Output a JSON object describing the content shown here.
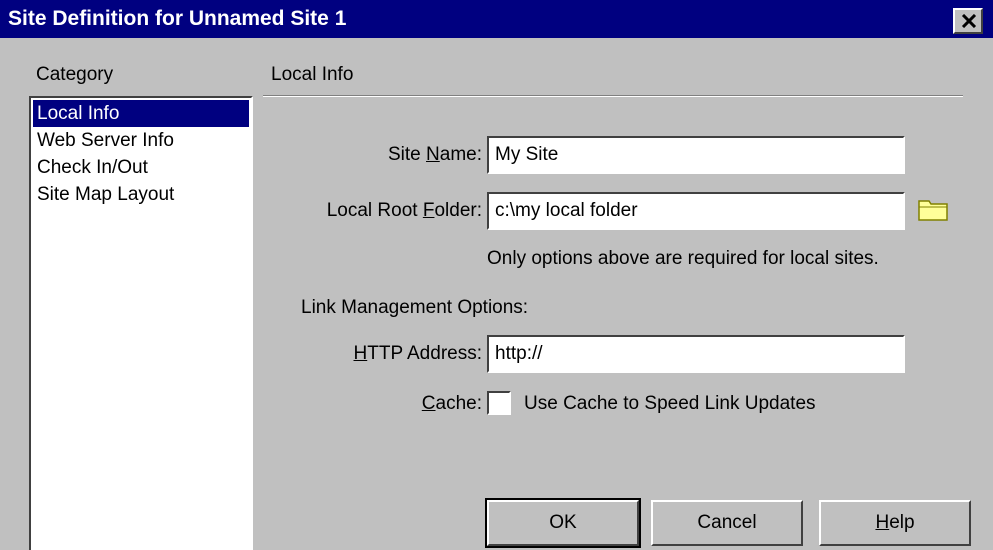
{
  "window": {
    "title": "Site Definition for Unnamed Site 1",
    "close_label": "×"
  },
  "category": {
    "label": "Category",
    "items": [
      {
        "label": "Local Info",
        "selected": true
      },
      {
        "label": "Web Server Info",
        "selected": false
      },
      {
        "label": "Check In/Out",
        "selected": false
      },
      {
        "label": "Site Map Layout",
        "selected": false
      }
    ]
  },
  "section": {
    "title": "Local Info"
  },
  "fields": {
    "site_name": {
      "label_pre": "Site ",
      "label_key": "N",
      "label_post": "ame:",
      "value": "My Site"
    },
    "local_root_folder": {
      "label_pre": "Local Root ",
      "label_key": "F",
      "label_post": "older:",
      "value": "c:\\my local folder"
    },
    "required_note": "Only options above are required for local sites.",
    "link_management_label": "Link Management Options:",
    "http_address": {
      "label_pre": "",
      "label_key": "H",
      "label_post": "TTP Address:",
      "value": "http://"
    },
    "cache": {
      "label_pre": "",
      "label_key": "C",
      "label_post": "ache:",
      "checkbox_label": "Use Cache to Speed Link Updates",
      "checked": false
    }
  },
  "buttons": {
    "ok": "OK",
    "cancel": "Cancel",
    "help_key": "H",
    "help_rest": "elp"
  },
  "colors": {
    "titlebar": "#000080",
    "face": "#c0c0c0",
    "selection": "#000080",
    "folder_icon": "#ffff99"
  },
  "icons": {
    "close": "close-icon",
    "folder": "folder-icon"
  }
}
